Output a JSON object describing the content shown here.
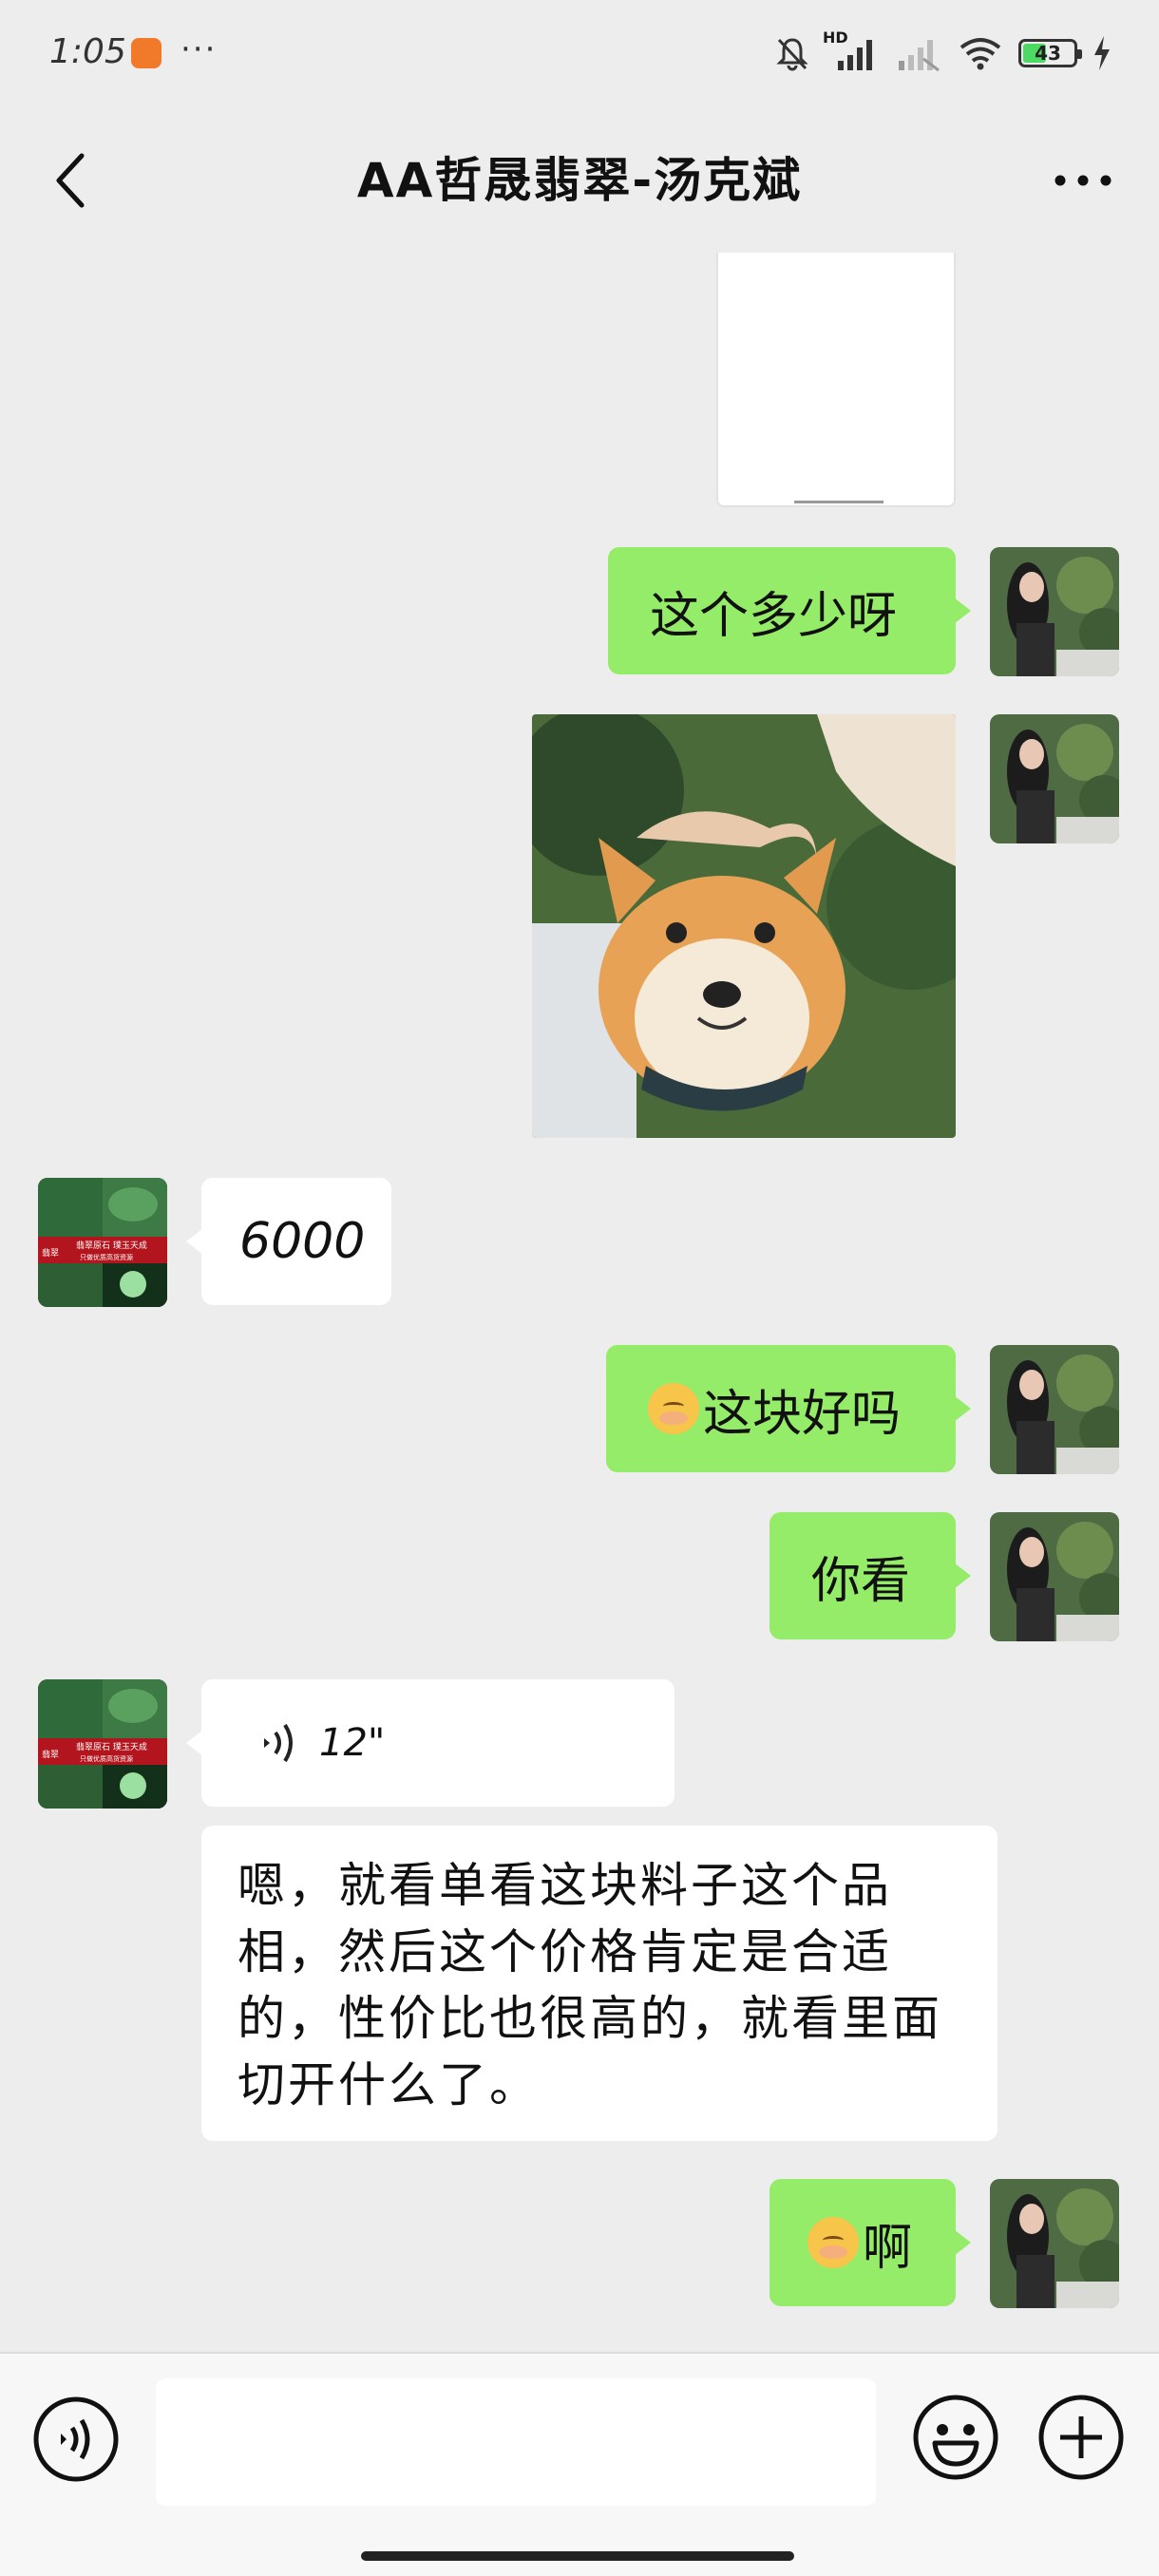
{
  "status_bar": {
    "time": "1:05",
    "more_dots": "···",
    "hd_label": "HD",
    "battery_level": "43",
    "battery_fraction": 0.43,
    "colors": {
      "battery_fill": "#4cd964",
      "app_icon": "#f07a2a"
    }
  },
  "nav": {
    "title": "AA哲晟翡翠-汤克斌",
    "back_icon": "chevron-left-icon",
    "more_icon": "more-horizontal-icon"
  },
  "messages": [
    {
      "id": "m0",
      "sender": "me",
      "type": "image",
      "content": "white image (partially visible)"
    },
    {
      "id": "m1",
      "sender": "me",
      "type": "text",
      "text": "这个多少呀"
    },
    {
      "id": "m2",
      "sender": "me",
      "type": "image",
      "content": "shiba dog photo"
    },
    {
      "id": "m3",
      "sender": "them",
      "type": "text",
      "text": "6000"
    },
    {
      "id": "m4",
      "sender": "me",
      "type": "text",
      "emoji": "smiling-face-emoji",
      "text": "这块好吗"
    },
    {
      "id": "m5",
      "sender": "me",
      "type": "text",
      "text": "你看"
    },
    {
      "id": "m6",
      "sender": "them",
      "type": "voice",
      "duration": "12\""
    },
    {
      "id": "m7",
      "sender": "them",
      "type": "text",
      "lines": [
        "嗯，就看单看这块料子这个品",
        "相，然后这个价格肯定是合适",
        "的，性价比也很高的，就看里面",
        "切开什么了。"
      ]
    },
    {
      "id": "m8",
      "sender": "me",
      "type": "text",
      "emoji": "smiling-face-emoji",
      "text": "啊"
    }
  ],
  "contact_avatar_text": {
    "line1": "翡翠原石 璞玉天成",
    "line2": "只做优质高货资源",
    "side": "翡翠"
  },
  "colors": {
    "bubble_me": "#95ec69",
    "bubble_them": "#ffffff",
    "background": "#ededed"
  },
  "input_bar": {
    "value": "",
    "voice_icon": "voice-input-icon",
    "emoji_icon": "emoji-icon",
    "plus_icon": "plus-circle-icon"
  }
}
